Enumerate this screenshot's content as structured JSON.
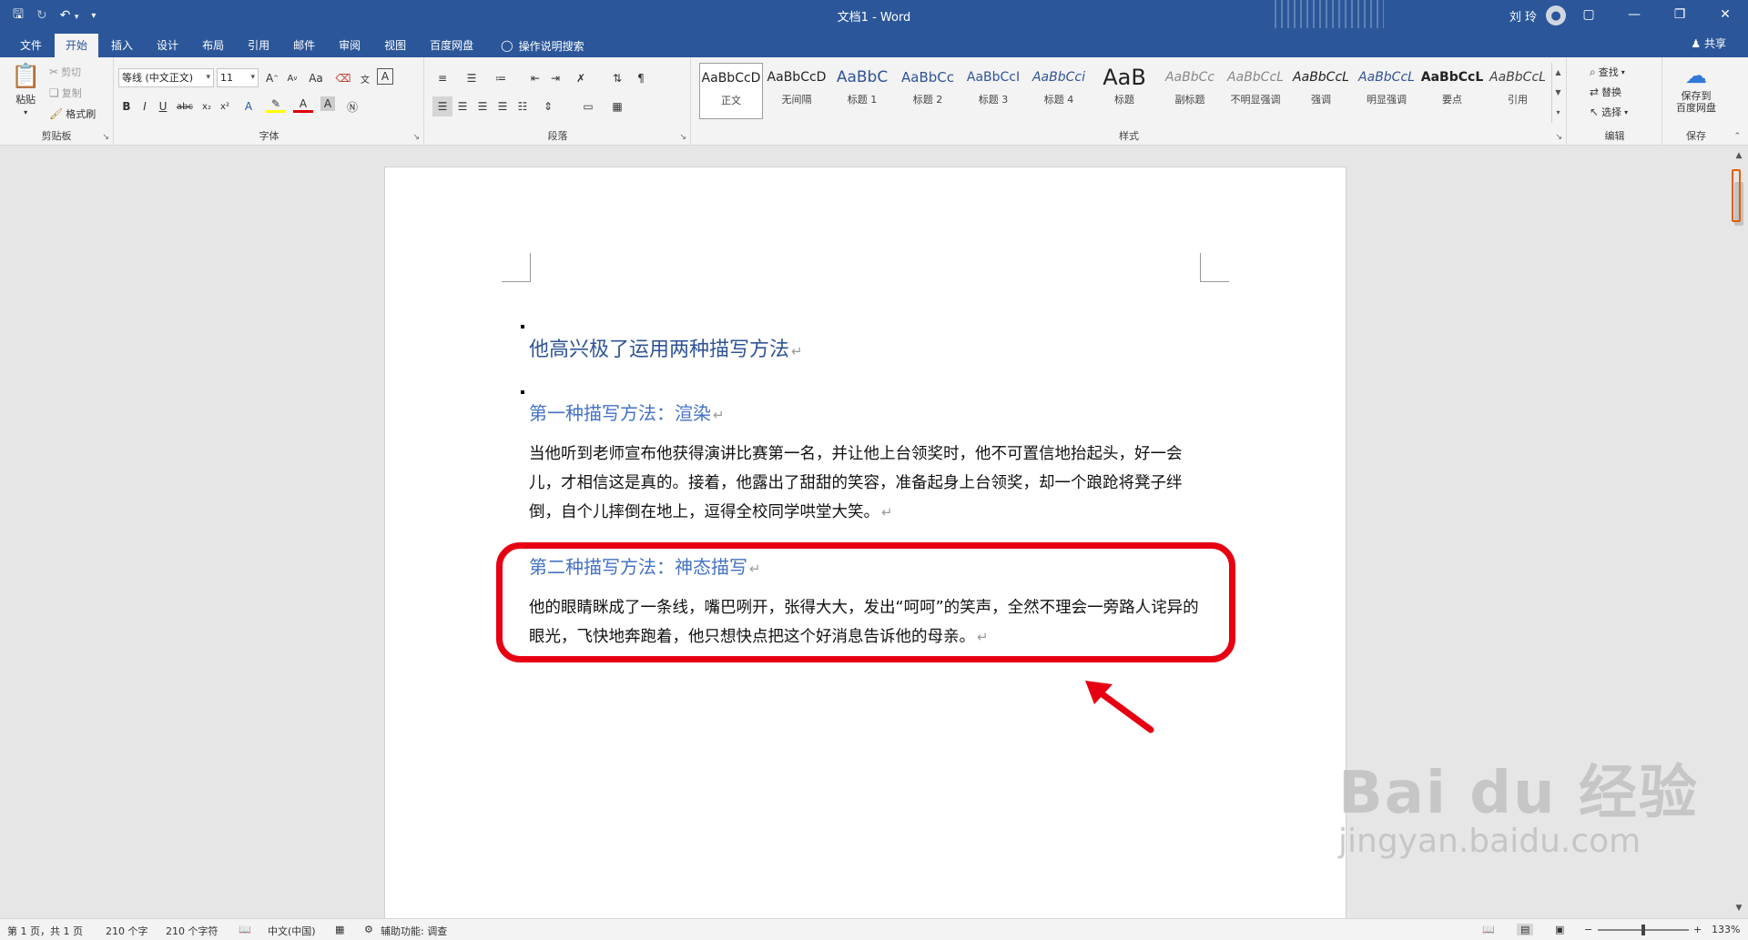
{
  "window": {
    "title": "文档1  -  Word",
    "user_name": "刘 玲"
  },
  "qat": {
    "save_icon": "save-icon",
    "redo_icon": "redo-icon",
    "undo_icon": "undo-icon"
  },
  "tabs": [
    {
      "label": "文件"
    },
    {
      "label": "开始"
    },
    {
      "label": "插入"
    },
    {
      "label": "设计"
    },
    {
      "label": "布局"
    },
    {
      "label": "引用"
    },
    {
      "label": "邮件"
    },
    {
      "label": "审阅"
    },
    {
      "label": "视图"
    },
    {
      "label": "百度网盘"
    }
  ],
  "tell_me": "操作说明搜索",
  "share": "共享",
  "clipboard": {
    "paste": "粘贴",
    "cut": "剪切",
    "copy": "复制",
    "format_painter": "格式刷",
    "label": "剪贴板"
  },
  "font": {
    "family": "等线 (中文正文)",
    "size": "11",
    "label": "字体"
  },
  "paragraph": {
    "label": "段落"
  },
  "styles": {
    "label": "样式",
    "items": [
      {
        "sample": "AaBbCcD",
        "name": "正文"
      },
      {
        "sample": "AaBbCcD",
        "name": "无间隔"
      },
      {
        "sample": "AaBbC",
        "name": "标题 1"
      },
      {
        "sample": "AaBbCc",
        "name": "标题 2"
      },
      {
        "sample": "AaBbCcI",
        "name": "标题 3"
      },
      {
        "sample": "AaBbCci",
        "name": "标题 4"
      },
      {
        "sample": "AaB",
        "name": "标题"
      },
      {
        "sample": "AaBbCc",
        "name": "副标题"
      },
      {
        "sample": "AaBbCcL",
        "name": "不明显强调"
      },
      {
        "sample": "AaBbCcL",
        "name": "强调"
      },
      {
        "sample": "AaBbCcL",
        "name": "明显强调"
      },
      {
        "sample": "AaBbCcL",
        "name": "要点"
      },
      {
        "sample": "AaBbCcL",
        "name": "引用"
      }
    ]
  },
  "editing": {
    "find": "查找",
    "replace": "替换",
    "select": "选择",
    "label": "编辑"
  },
  "save_group": {
    "button": "保存到\n百度网盘",
    "label": "保存"
  },
  "document": {
    "title": "他高兴极了运用两种描写方法",
    "heading1": "第一种描写方法：渲染",
    "paragraph1": "当他听到老师宣布他获得演讲比赛第一名，并让他上台领奖时，他不可置信地抬起头，好一会儿，才相信这是真的。接着，他露出了甜甜的笑容，准备起身上台领奖，却一个踉跄将凳子绊倒，自个儿摔倒在地上，逗得全校同学哄堂大笑。",
    "heading2": "第二种描写方法：神态描写",
    "paragraph2": "他的眼睛眯成了一条线，嘴巴咧开，张得大大，发出“呵呵”的笑声，全然不理会一旁路人诧异的眼光，飞快地奔跑着，他只想快点把这个好消息告诉他的母亲。",
    "para_mark": "↵"
  },
  "status": {
    "page": "第 1 页，共 1 页",
    "words": "210 个字",
    "chars": "210 个字符",
    "language": "中文(中国)",
    "accessibility": "辅助功能: 调查",
    "zoom": "133%"
  },
  "watermark": {
    "logo": "Bai du 经验",
    "url": "jingyan.baidu.com"
  },
  "colors": {
    "title_bar": "#2b579a",
    "heading1": "#2f5496",
    "heading2": "#4472c4",
    "highlight": "#e60012"
  }
}
